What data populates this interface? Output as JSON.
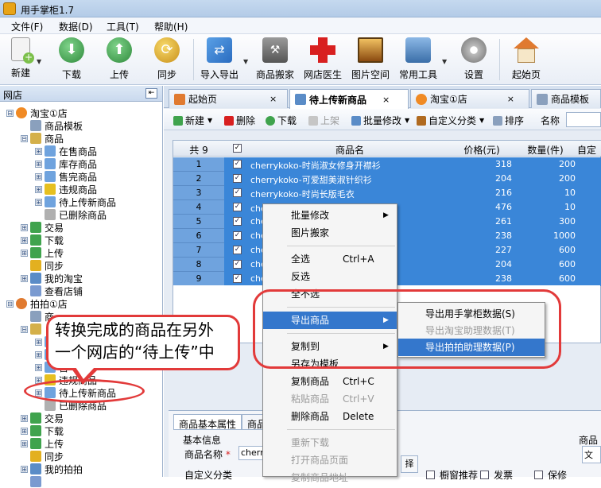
{
  "window": {
    "title": "用手掌柜1.7"
  },
  "menu": [
    "文件(F)",
    "数据(D)",
    "工具(T)",
    "帮助(H)"
  ],
  "toolbar": [
    {
      "label": "新建",
      "icon": "new-doc-icon",
      "color": "#7cc04b"
    },
    {
      "label": "下载",
      "icon": "download-icon",
      "color": "#3fa34d"
    },
    {
      "label": "上传",
      "icon": "upload-icon",
      "color": "#3fa34d"
    },
    {
      "label": "同步",
      "icon": "sync-icon",
      "color": "#e3b020"
    },
    {
      "label": "导入导出",
      "icon": "import-export-icon",
      "color": "#3a7fd6"
    },
    {
      "label": "商品搬家",
      "icon": "move-goods-icon",
      "color": "#6b6b6b"
    },
    {
      "label": "网店医生",
      "icon": "doctor-cross-icon",
      "color": "#d82020"
    },
    {
      "label": "图片空间",
      "icon": "image-space-icon",
      "color": "#b07020"
    },
    {
      "label": "常用工具",
      "icon": "toolbox-icon",
      "color": "#4a7fb8"
    },
    {
      "label": "设置",
      "icon": "gear-icon",
      "color": "#8c8c8c"
    },
    {
      "label": "起始页",
      "icon": "home-icon",
      "color": "#e07a30"
    }
  ],
  "sidebar": {
    "header": "网店",
    "tree": [
      {
        "label": "淘宝①店",
        "level": 0,
        "exp": "⊟",
        "icon": "taobao-icon"
      },
      {
        "label": "商品模板",
        "level": 1,
        "exp": "",
        "icon": "template-icon"
      },
      {
        "label": "商品",
        "level": 1,
        "exp": "⊟",
        "icon": "goods-folder-icon"
      },
      {
        "label": "在售商品",
        "level": 2,
        "exp": "⊞",
        "icon": "goods-icon"
      },
      {
        "label": "库存商品",
        "level": 2,
        "exp": "⊞",
        "icon": "goods-icon"
      },
      {
        "label": "售完商品",
        "level": 2,
        "exp": "⊞",
        "icon": "goods-icon"
      },
      {
        "label": "违规商品",
        "level": 2,
        "exp": "⊞",
        "icon": "warning-icon"
      },
      {
        "label": "待上传新商品",
        "level": 2,
        "exp": "⊞",
        "icon": "goods-icon"
      },
      {
        "label": "已删除商品",
        "level": 2,
        "exp": "",
        "icon": "trash-icon"
      },
      {
        "label": "交易",
        "level": 1,
        "exp": "⊞",
        "icon": "trade-icon"
      },
      {
        "label": "下载",
        "level": 1,
        "exp": "⊞",
        "icon": "download-icon"
      },
      {
        "label": "上传",
        "level": 1,
        "exp": "⊞",
        "icon": "upload-icon"
      },
      {
        "label": "同步",
        "level": 1,
        "exp": "",
        "icon": "sync-icon"
      },
      {
        "label": "我的淘宝",
        "level": 1,
        "exp": "⊞",
        "icon": "my-taobao-icon"
      },
      {
        "label": "查看店铺",
        "level": 1,
        "exp": "",
        "icon": "view-shop-icon"
      },
      {
        "label": "拍拍①店",
        "level": 0,
        "exp": "⊟",
        "icon": "paipai-icon"
      },
      {
        "label": "商",
        "level": 1,
        "exp": "",
        "icon": "template-icon"
      },
      {
        "label": "",
        "level": 1,
        "exp": "⊟",
        "icon": "goods-folder-icon"
      },
      {
        "label": "",
        "level": 2,
        "exp": "⊞",
        "icon": "goods-icon"
      },
      {
        "label": "",
        "level": 2,
        "exp": "⊞",
        "icon": "goods-icon"
      },
      {
        "label": "售",
        "level": 2,
        "exp": "⊞",
        "icon": "goods-icon"
      },
      {
        "label": "违规商品",
        "level": 2,
        "exp": "⊞",
        "icon": "warning-icon"
      },
      {
        "label": "待上传新商品",
        "level": 2,
        "exp": "⊞",
        "icon": "goods-icon"
      },
      {
        "label": "已删除商品",
        "level": 2,
        "exp": "",
        "icon": "trash-icon"
      },
      {
        "label": "交易",
        "level": 1,
        "exp": "⊞",
        "icon": "trade-icon"
      },
      {
        "label": "下载",
        "level": 1,
        "exp": "⊞",
        "icon": "download-icon"
      },
      {
        "label": "上传",
        "level": 1,
        "exp": "⊞",
        "icon": "upload-icon"
      },
      {
        "label": "同步",
        "level": 1,
        "exp": "",
        "icon": "sync-icon"
      },
      {
        "label": "我的拍拍",
        "level": 1,
        "exp": "⊞",
        "icon": "my-paipai-icon"
      },
      {
        "label": "",
        "level": 1,
        "exp": "",
        "icon": "view-shop-icon"
      }
    ]
  },
  "tabs": [
    {
      "label": "起始页",
      "close": "×",
      "active": false
    },
    {
      "label": "待上传新商品",
      "close": "×",
      "active": true
    },
    {
      "label": "淘宝①店",
      "close": "×",
      "active": false
    },
    {
      "label": "商品模板",
      "close": "",
      "active": false
    }
  ],
  "subtoolbar": {
    "new": "新建",
    "delete": "删除",
    "download": "下载",
    "upload": "上架",
    "batch": "批量修改",
    "category": "自定义分类",
    "sort": "排序",
    "name_label": "名称"
  },
  "grid": {
    "count_label": "共 9",
    "headers": {
      "name": "商品名",
      "price": "价格(元)",
      "qty": "数量(件)",
      "custom": "自定"
    },
    "rows": [
      {
        "n": "1",
        "name": "cherrykoko-时尚淑女修身开襟衫",
        "price": "318",
        "qty": "200"
      },
      {
        "n": "2",
        "name": "cherrykoko-可爱甜美淑针织衫",
        "price": "204",
        "qty": "200"
      },
      {
        "n": "3",
        "name": "cherrykoko-时尚长版毛衣",
        "price": "216",
        "qty": "10"
      },
      {
        "n": "4",
        "name": "cherrykoko-修身",
        "price": "476",
        "qty": "10"
      },
      {
        "n": "5",
        "name": "che",
        "price": "261",
        "qty": "300"
      },
      {
        "n": "6",
        "name": "che",
        "price": "238",
        "qty": "1000"
      },
      {
        "n": "7",
        "name": "che",
        "price": "227",
        "qty": "600"
      },
      {
        "n": "8",
        "name": "che",
        "price": "204",
        "qty": "600"
      },
      {
        "n": "9",
        "name": "che",
        "price": "238",
        "qty": "600"
      }
    ]
  },
  "context_menu": [
    {
      "label": "批量修改",
      "shortcut": "",
      "arrow": "▶",
      "disabled": false,
      "hl": false
    },
    {
      "label": "图片搬家",
      "shortcut": "",
      "arrow": "",
      "disabled": false,
      "hl": false
    },
    {
      "sep": true
    },
    {
      "label": "全选",
      "shortcut": "Ctrl+A",
      "arrow": "",
      "disabled": false,
      "hl": false
    },
    {
      "label": "反选",
      "shortcut": "",
      "arrow": "",
      "disabled": false,
      "hl": false
    },
    {
      "label": "全不选",
      "shortcut": "",
      "arrow": "",
      "disabled": false,
      "hl": false
    },
    {
      "sep": true
    },
    {
      "label": "导出商品",
      "shortcut": "",
      "arrow": "▶",
      "disabled": false,
      "hl": true
    },
    {
      "sep": true
    },
    {
      "label": "复制到",
      "shortcut": "",
      "arrow": "▶",
      "disabled": false,
      "hl": false
    },
    {
      "label": "另存为模板",
      "shortcut": "",
      "arrow": "",
      "disabled": false,
      "hl": false
    },
    {
      "label": "复制商品",
      "shortcut": "Ctrl+C",
      "arrow": "",
      "disabled": false,
      "hl": false
    },
    {
      "label": "粘贴商品",
      "shortcut": "Ctrl+V",
      "arrow": "",
      "disabled": true,
      "hl": false
    },
    {
      "label": "删除商品",
      "shortcut": "Delete",
      "arrow": "",
      "disabled": false,
      "hl": false
    },
    {
      "sep": true
    },
    {
      "label": "重新下载",
      "shortcut": "",
      "arrow": "",
      "disabled": true,
      "hl": false
    },
    {
      "label": "打开商品页面",
      "shortcut": "",
      "arrow": "",
      "disabled": true,
      "hl": false
    },
    {
      "label": "复制商品地址",
      "shortcut": "",
      "arrow": "",
      "disabled": true,
      "hl": false
    }
  ],
  "submenu": [
    {
      "label": "导出用手掌柜数据(S)",
      "disabled": false,
      "hl": false
    },
    {
      "label": "导出淘宝助理数据(T)",
      "disabled": true,
      "hl": false
    },
    {
      "label": "导出拍拍助理数据(P)",
      "disabled": false,
      "hl": true
    }
  ],
  "lower": {
    "tab1": "商品基本属性",
    "tab2": "商品",
    "section": "基本信息",
    "name_label": "商品名称",
    "name_value": "cherry",
    "custom_label": "自定义分类",
    "cb1": "橱窗推荐",
    "cb2": "发票",
    "cb3": "保修",
    "right_label": "商品",
    "right_btn": "文"
  },
  "annotation": {
    "line1": "转换完成的商品在另外",
    "line2": "一个网店的“待上传”中"
  }
}
